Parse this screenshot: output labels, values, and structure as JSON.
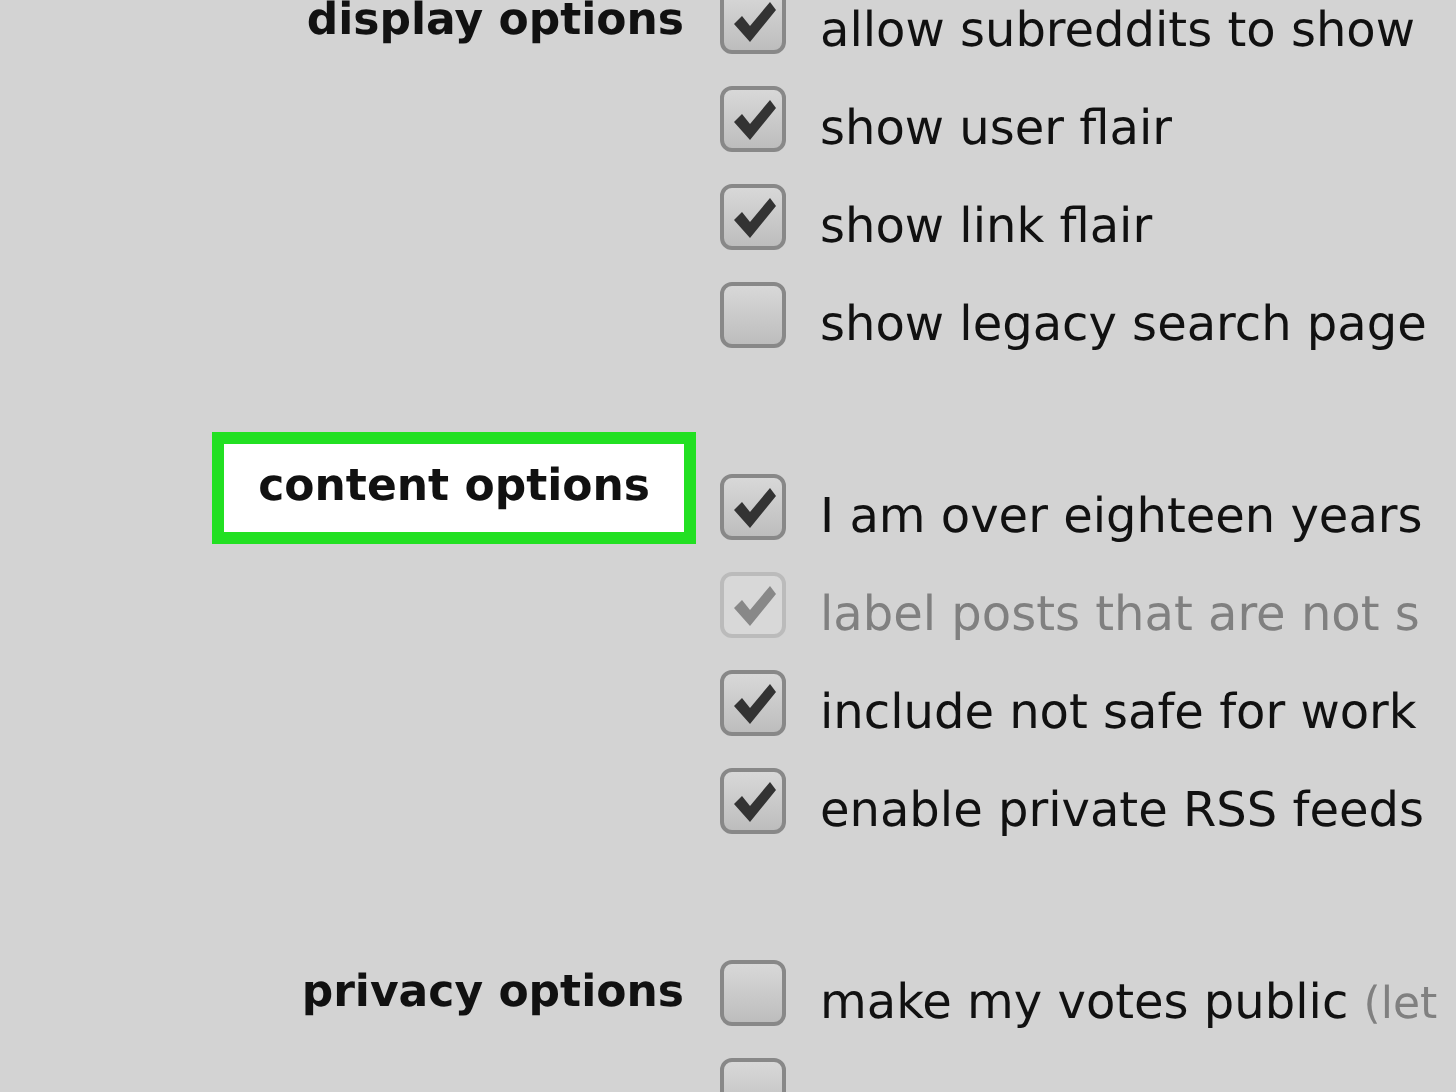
{
  "sections": [
    {
      "title": "display options",
      "highlighted": false,
      "options": [
        {
          "label": "allow subreddits to show",
          "checked": true,
          "disabled": false
        },
        {
          "label": "show user flair",
          "checked": true,
          "disabled": false
        },
        {
          "label": "show link flair",
          "checked": true,
          "disabled": false
        },
        {
          "label": "show legacy search page",
          "checked": false,
          "disabled": false
        }
      ]
    },
    {
      "title": "content options",
      "highlighted": true,
      "options": [
        {
          "label": "I am over eighteen years",
          "checked": true,
          "disabled": false
        },
        {
          "label": "label posts that are not s",
          "checked": true,
          "disabled": true
        },
        {
          "label": "include not safe for work",
          "checked": true,
          "disabled": false
        },
        {
          "label": "enable private RSS feeds",
          "checked": true,
          "disabled": false
        }
      ]
    },
    {
      "title": "privacy options",
      "highlighted": false,
      "options": [
        {
          "label": "make my votes public",
          "note": "(let",
          "checked": false,
          "disabled": false
        },
        {
          "checked": false,
          "disabled": false
        }
      ]
    }
  ]
}
